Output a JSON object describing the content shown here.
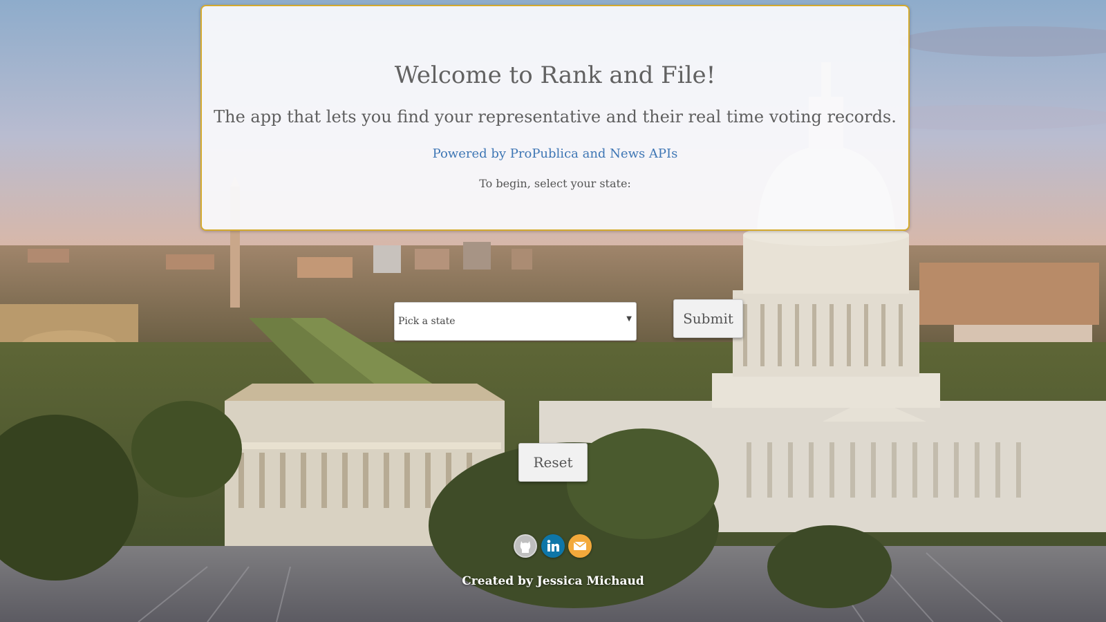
{
  "hero": {
    "title": "Welcome to Rank and File!",
    "subtitle": "The app that lets you find your representative and their real time voting records.",
    "powered_by": "Powered by ProPublica and News APIs",
    "instruction": "To begin, select your state:"
  },
  "form": {
    "state_select": {
      "selected": "Pick a state"
    },
    "submit_label": "Submit",
    "reset_label": "Reset"
  },
  "social": [
    {
      "name": "github-icon"
    },
    {
      "name": "linkedin-icon"
    },
    {
      "name": "email-icon"
    }
  ],
  "footer": {
    "credit": "Created by Jessica Michaud"
  },
  "colors": {
    "accent_border": "#d4aa2e",
    "link": "#3e76b4",
    "linkedin": "#0e76a8",
    "email": "#f3a93b"
  }
}
